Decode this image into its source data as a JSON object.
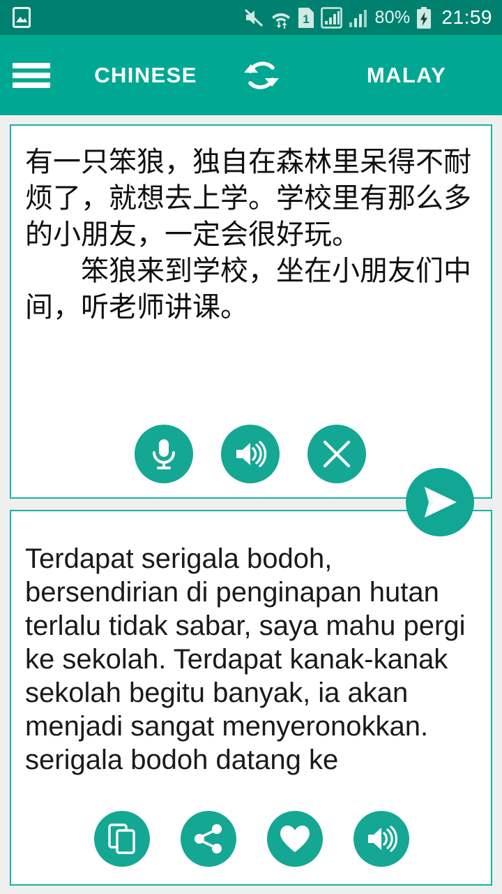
{
  "statusbar": {
    "left_icons": [
      {
        "name": "photo-icon",
        "glyph": "image"
      }
    ],
    "right_icons": [
      {
        "name": "mute-icon",
        "glyph": "speaker-muted"
      },
      {
        "name": "wifi-icon",
        "glyph": "wifi-transfer"
      },
      {
        "name": "sim-card-icon",
        "glyph": "sim-1",
        "label": "1"
      },
      {
        "name": "signal-strength-icon-1",
        "glyph": "signal-boxed"
      },
      {
        "name": "signal-strength-icon-2",
        "glyph": "signal-bars"
      }
    ],
    "battery_percent": "80%",
    "battery_state": "charging",
    "clock": "21:59",
    "background_color": "#00816f",
    "foreground_color": "#eaf6f3"
  },
  "appbar": {
    "menu_label": "menu",
    "source_language": "CHINESE",
    "target_language": "MALAY",
    "swap_label": "swap-languages",
    "background_color": "#00a894",
    "text_color": "#ffffff"
  },
  "source_card": {
    "text": "有一只笨狼，独自在森林里呆得不耐烦了，就想去上学。学校里有那么多的小朋友，一定会很好玩。\n　　笨狼来到学校，坐在小朋友们中间，听老师讲课。",
    "border_color": "#14b5a0",
    "buttons": [
      {
        "name": "microphone-button",
        "icon": "microphone-icon",
        "label": "Speak"
      },
      {
        "name": "speak-source-button",
        "icon": "speaker-icon",
        "label": "Listen"
      },
      {
        "name": "clear-text-button",
        "icon": "close-icon",
        "label": "Clear"
      }
    ]
  },
  "translate_button": {
    "name": "translate-send-button",
    "icon": "send-icon",
    "label": "Translate",
    "color": "#12a694"
  },
  "target_card": {
    "text": "Terdapat serigala bodoh, bersendirian di penginapan hutan terlalu tidak sabar, saya mahu pergi ke sekolah. Terdapat kanak-kanak sekolah begitu banyak, ia akan menjadi sangat menyeronokkan.\nserigala bodoh datang ke",
    "border_color": "#14b5a0",
    "buttons": [
      {
        "name": "copy-button",
        "icon": "copy-icon",
        "label": "Copy"
      },
      {
        "name": "share-button",
        "icon": "share-icon",
        "label": "Share"
      },
      {
        "name": "favorite-button",
        "icon": "heart-icon",
        "label": "Favourite"
      },
      {
        "name": "speak-target-button",
        "icon": "speaker-icon",
        "label": "Listen"
      }
    ]
  },
  "theme": {
    "accent": "#14a794",
    "page_background": "#efefef",
    "card_background": "#ffffff"
  }
}
